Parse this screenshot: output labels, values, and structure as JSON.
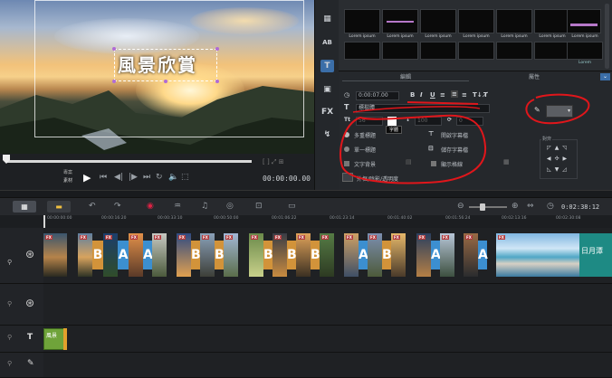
{
  "preview": {
    "title_text": "風景欣賞",
    "mode_label_1": "專案",
    "mode_label_2": "素材",
    "timecode": "00:00:00.00"
  },
  "library": {
    "thumb_label": "Lorem ipsum",
    "thumb_label_alt": "Lorem"
  },
  "options": {
    "tab_edit": "編輯",
    "tab_attributes": "屬性",
    "duration": "0:00:07.00",
    "font_name": "標楷體",
    "font_size": "56",
    "line_spacing": "100",
    "rotation": "0",
    "tooltip_font_color": "字體",
    "multi_title": "多重標題",
    "single_title": "單一標題",
    "text_background": "文字背景",
    "open_subtitle": "開啟字幕檔",
    "save_subtitle": "儲存字幕檔",
    "show_grid": "顯示格線",
    "border_shadow": "外框/陰影/透明度",
    "alignment_label": "對齊",
    "accent_red": "#e0161b"
  },
  "timeline": {
    "timecode": "0:02:38:12",
    "ruler": [
      "00:00:00:00",
      "00:00:16:20",
      "00:00:33:10",
      "00:00:50:00",
      "00:01:06:22",
      "00:01:23:14",
      "00:01:40:02",
      "00:01:56:24",
      "00:02:13:16",
      "00:02:30:08"
    ],
    "end_clip_label": "日月潭",
    "title_clip_label": "風景"
  }
}
